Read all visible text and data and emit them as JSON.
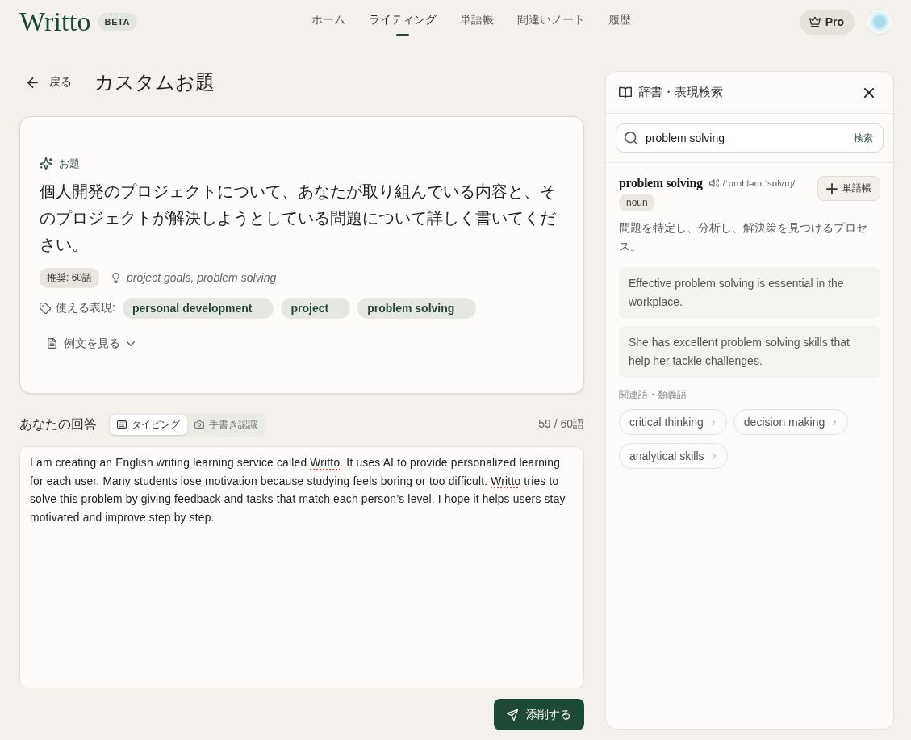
{
  "header": {
    "logo": "Writto",
    "badge": "BETA",
    "nav": [
      {
        "label": "ホーム",
        "selected": false
      },
      {
        "label": "ライティング",
        "selected": true
      },
      {
        "label": "単語帳",
        "selected": false
      },
      {
        "label": "間違いノート",
        "selected": false
      },
      {
        "label": "履歴",
        "selected": false
      }
    ],
    "pro_button": "Pro"
  },
  "page": {
    "back": "戻る",
    "title": "カスタムお題"
  },
  "prompt_card": {
    "label": "お題",
    "text": "個人開発のプロジェクトについて、あなたが取り組んでいる内容と、そのプロジェクトが解決しようとしている問題について詳しく書いてください。",
    "recommended": "推奨: 60語",
    "hint": "project goals, problem solving",
    "expressions_label": "使える表現:",
    "expressions": [
      "personal development",
      "project",
      "problem solving"
    ],
    "examples_toggle": {
      "label": "例文を見る",
      "expanded": false
    }
  },
  "answer": {
    "title": "あなたの回答",
    "modes": [
      {
        "label": "タイピング",
        "selected": true
      },
      {
        "label": "手書き認識",
        "selected": false
      }
    ],
    "count": "59 / 60語",
    "segments": [
      {
        "text": "I am creating an English writing learning service called ",
        "misspelled": false
      },
      {
        "text": "Writto",
        "misspelled": true
      },
      {
        "text": ". It uses AI to provide personalized learning for each user. Many students lose motivation because studying feels boring or too difficult. ",
        "misspelled": false
      },
      {
        "text": "Writto",
        "misspelled": true
      },
      {
        "text": " tries to solve this problem by giving feedback and tasks that match each person’s level. I hope it helps users stay motivated and improve step by step.",
        "misspelled": false
      }
    ],
    "submit": "添削する"
  },
  "dictionary": {
    "title": "辞書・表現検索",
    "search": {
      "value": "problem solving",
      "button": "検索"
    },
    "entry": {
      "headword": "problem solving",
      "pronunciation": "/ˈprɒbləm ˈsɒlvɪŋ/",
      "add_button": "単語帳",
      "part_of_speech": "noun",
      "definition": "問題を特定し、分析し、解決策を見つけるプロセス。",
      "examples": [
        "Effective problem solving is essential in the workplace.",
        "She has excellent problem solving skills that help her tackle challenges."
      ]
    },
    "related_label": "関連語・類義語",
    "related": [
      "critical thinking",
      "decision making",
      "analytical skills"
    ]
  }
}
